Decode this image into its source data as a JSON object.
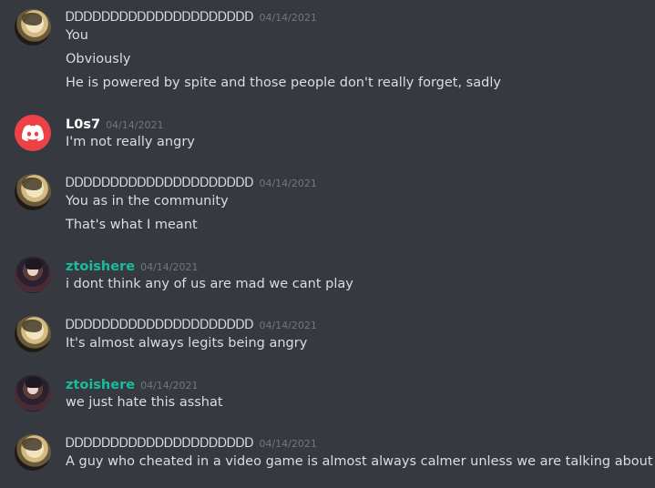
{
  "messages": [
    {
      "avatar": "anime-character-avatar",
      "username": "ᎠᎠᎠᎠᎠᎠᎠᎠᎠᎠᎠᎠᎠᎠᎠᎠᎠᎠᎠᎠᎠ",
      "timestamp": "04/14/2021",
      "lines": [
        "You",
        "Obviously",
        "He is powered by spite and those people don't really forget, sadly"
      ]
    },
    {
      "avatar": "discord-default-avatar",
      "username": "L0s7",
      "timestamp": "04/14/2021",
      "lines": [
        "I'm not really angry"
      ]
    },
    {
      "avatar": "anime-character-avatar",
      "username": "ᎠᎠᎠᎠᎠᎠᎠᎠᎠᎠᎠᎠᎠᎠᎠᎠᎠᎠᎠᎠᎠ",
      "timestamp": "04/14/2021",
      "lines": [
        "You as in the community",
        "That's what I meant"
      ]
    },
    {
      "avatar": "anime-dark-avatar",
      "username": "ztoishere",
      "timestamp": "04/14/2021",
      "lines": [
        "i dont think any of us are mad we cant play"
      ]
    },
    {
      "avatar": "anime-character-avatar",
      "username": "ᎠᎠᎠᎠᎠᎠᎠᎠᎠᎠᎠᎠᎠᎠᎠᎠᎠᎠᎠᎠᎠ",
      "timestamp": "04/14/2021",
      "lines": [
        "It's almost always legits being angry"
      ]
    },
    {
      "avatar": "anime-dark-avatar",
      "username": "ztoishere",
      "timestamp": "04/14/2021",
      "lines": [
        "we just hate this asshat"
      ]
    },
    {
      "avatar": "anime-character-avatar",
      "username": "ᎠᎠᎠᎠᎠᎠᎠᎠᎠᎠᎠᎠᎠᎠᎠᎠᎠᎠᎠᎠᎠ",
      "timestamp": "04/14/2021",
      "lines": [
        "A guy who cheated in a video game is almost always calmer unless we are talking about HvH"
      ]
    }
  ],
  "colors": {
    "background": "#36393f",
    "text": "#dcddde",
    "timestamp": "#72767d",
    "username_green": "#1abc9c",
    "discord_red": "#ed4245"
  }
}
